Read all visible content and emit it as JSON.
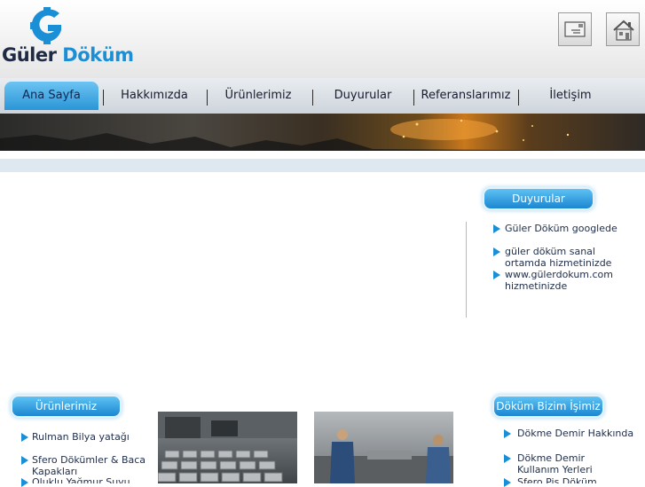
{
  "brand": {
    "letter": "G",
    "word1": "Güler",
    "word2": "Döküm",
    "colors": {
      "blue": "#1b8fd6",
      "dark": "#1f2a44"
    }
  },
  "header_icons": [
    {
      "icon": "mail-icon"
    },
    {
      "icon": "home-icon"
    }
  ],
  "nav": [
    "Ana Sayfa",
    "Hakkımızda",
    "Ürünlerimiz",
    "Duyurular",
    "Referanslarımız",
    "İletişim"
  ],
  "duyurular": {
    "title": "Duyurular",
    "items": [
      "Güler Döküm googlede",
      "güler döküm sanal ortamda hizmetinizde",
      "www.gülerdokum.com hizmetinizde"
    ]
  },
  "urunlerimiz": {
    "title": "Ürünlerimiz",
    "items": [
      "Rulman Bilya yatağı",
      "Sfero Dökümler & Baca Kapakları",
      "Oluklu Yağmur Suyu"
    ]
  },
  "dokum": {
    "title": "Döküm Bizim İşimiz",
    "items": [
      "Dökme Demir Hakkında",
      "Dökme Demir Kullanım Yerleri",
      "Sfero Pis Döküm"
    ]
  }
}
